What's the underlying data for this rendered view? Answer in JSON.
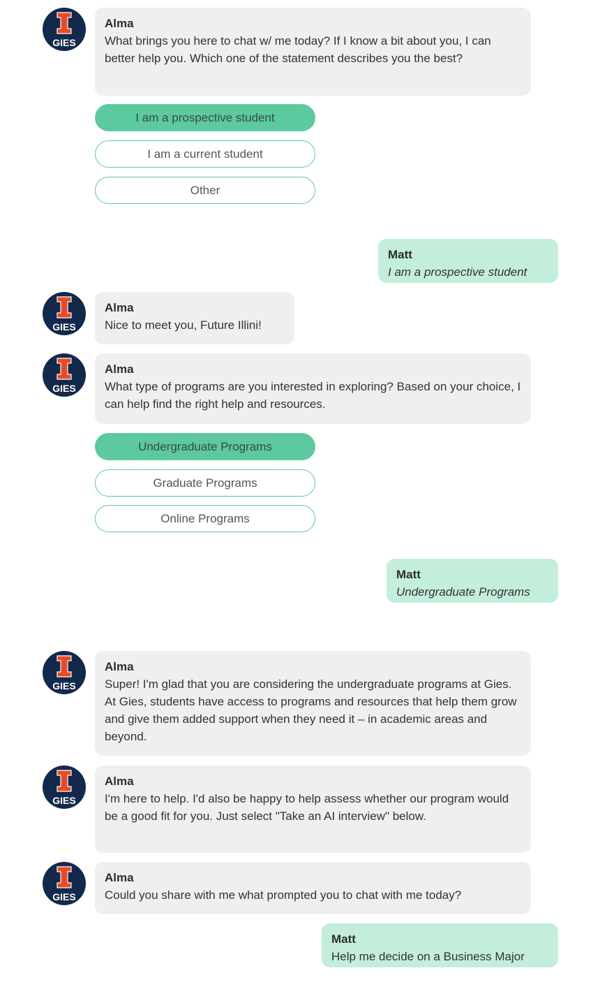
{
  "avatar": {
    "label": "GIES",
    "letter": "I",
    "bg_color": "#13294b",
    "letter_color": "#e84a27"
  },
  "colors": {
    "bot_bubble": "#efefef",
    "user_bubble": "#c3eedb",
    "choice_selected": "#5cc99f",
    "choice_border": "#5bc9a0"
  },
  "messages": [
    {
      "sender": "Alma",
      "text": "What brings you here to chat w/ me today? If I know a bit about you, I can better help you. Which one of the statement describes you the best?"
    },
    {
      "sender": "Alma",
      "text": "Nice to meet you, Future Illini!"
    },
    {
      "sender": "Alma",
      "text": "What type of programs are you interested in exploring? Based on your choice, I can help find the right help and resources."
    },
    {
      "sender": "Alma",
      "text": "Super! I'm glad that you are considering the undergraduate programs at Gies. At Gies, students have access to programs and resources that help them grow and give them added support when they need it – in academic areas and beyond."
    },
    {
      "sender": "Alma",
      "text": "I'm here to help. I'd also be happy to help assess whether our program would be a good fit for you. Just select \"Take an AI interview\" below."
    },
    {
      "sender": "Alma",
      "text": "Could you share with me what prompted you to chat with me today?"
    }
  ],
  "user_messages": [
    {
      "sender": "Matt",
      "text": "I am a prospective student"
    },
    {
      "sender": "Matt",
      "text": "Undergraduate Programs"
    },
    {
      "sender": "Matt",
      "text": "Help me decide on a Business Major"
    }
  ],
  "choice_groups": [
    {
      "options": [
        "I am a prospective student",
        "I am a current student",
        "Other"
      ],
      "selected": "I am a prospective student"
    },
    {
      "options": [
        "Undergraduate Programs",
        "Graduate Programs",
        "Online Programs"
      ],
      "selected": "Undergraduate Programs"
    }
  ]
}
